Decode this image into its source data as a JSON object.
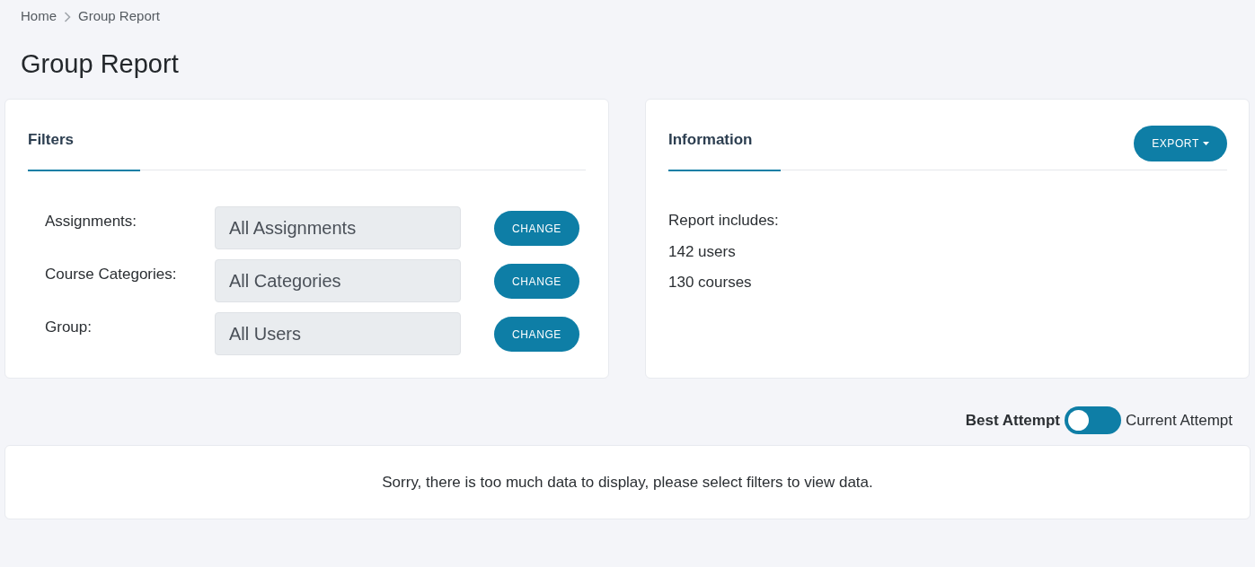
{
  "breadcrumb": [
    {
      "label": "Home"
    },
    {
      "label": "Group Report"
    }
  ],
  "title": "Group Report",
  "filters": {
    "tab": "Filters",
    "rows": [
      {
        "label": "Assignments:",
        "value": "All Assignments",
        "button": "CHANGE"
      },
      {
        "label": "Course Categories:",
        "value": "All Categories",
        "button": "CHANGE"
      },
      {
        "label": "Group:",
        "value": "All Users",
        "button": "CHANGE"
      }
    ]
  },
  "information": {
    "tab": "Information",
    "export_button": "EXPORT",
    "lines": [
      "Report includes:",
      "142 users",
      "130 courses"
    ]
  },
  "attempt_toggle": {
    "left_label": "Best Attempt",
    "right_label": "Current Attempt",
    "on": false
  },
  "message": "Sorry, there is too much data to display, please select filters to view data."
}
